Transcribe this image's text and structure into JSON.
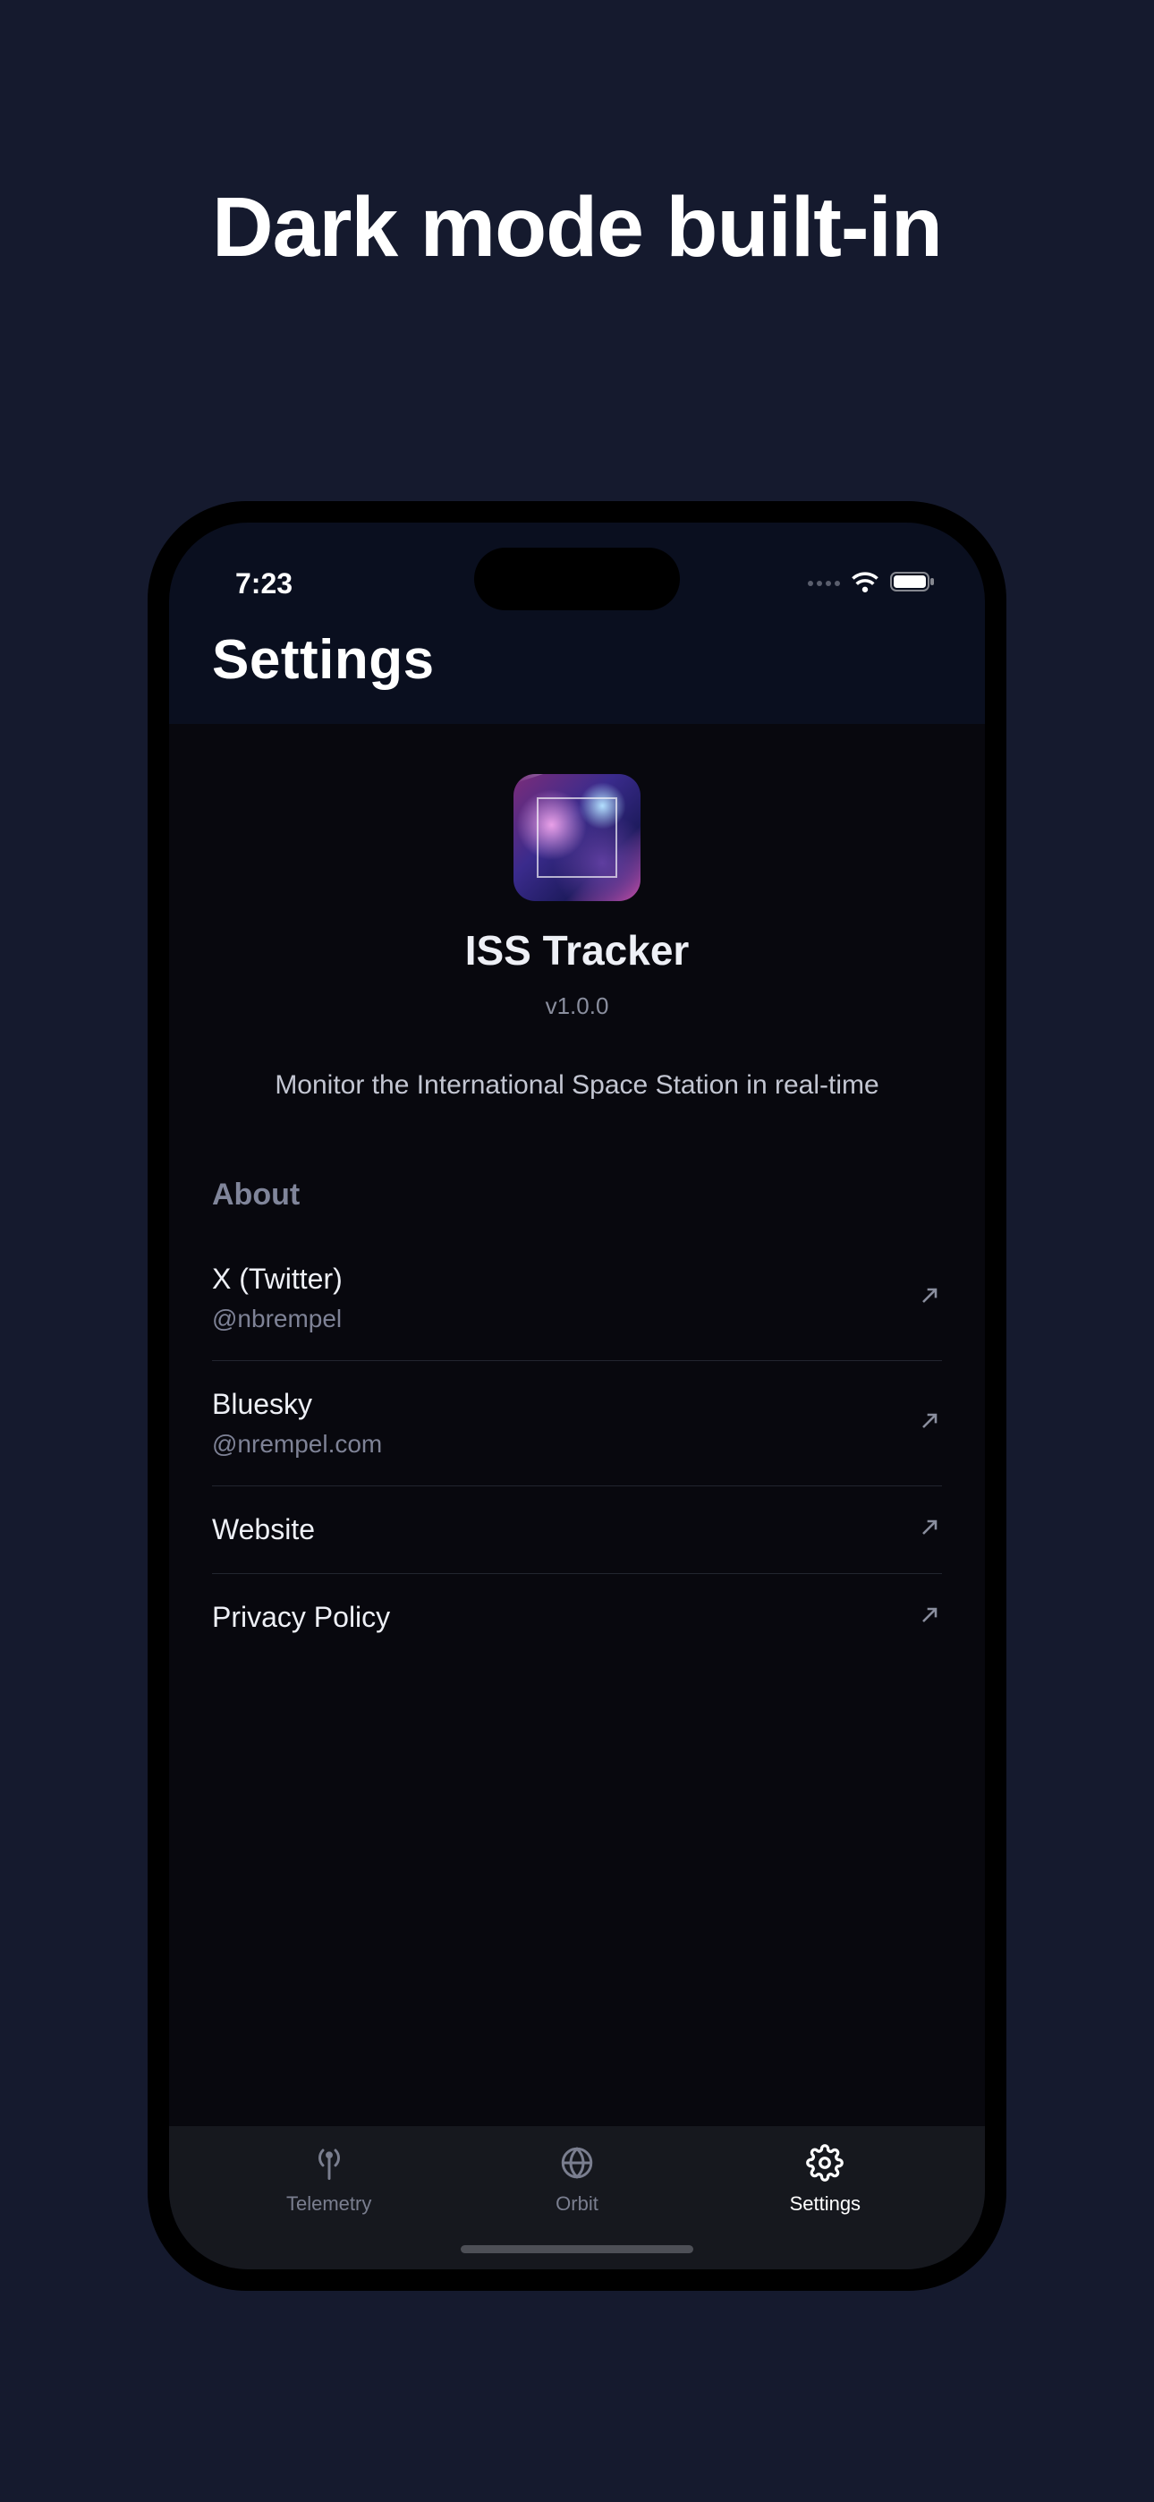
{
  "hero": {
    "title": "Dark mode built-in"
  },
  "statusBar": {
    "time": "7:23"
  },
  "header": {
    "title": "Settings"
  },
  "app": {
    "name": "ISS Tracker",
    "version": "v1.0.0",
    "description": "Monitor the International Space Station in real-time"
  },
  "aboutSection": {
    "header": "About",
    "items": [
      {
        "title": "X (Twitter)",
        "subtitle": "@nbrempel"
      },
      {
        "title": "Bluesky",
        "subtitle": "@nrempel.com"
      },
      {
        "title": "Website",
        "subtitle": ""
      },
      {
        "title": "Privacy Policy",
        "subtitle": ""
      }
    ]
  },
  "tabs": {
    "items": [
      {
        "label": "Telemetry",
        "active": false
      },
      {
        "label": "Orbit",
        "active": false
      },
      {
        "label": "Settings",
        "active": true
      }
    ]
  }
}
